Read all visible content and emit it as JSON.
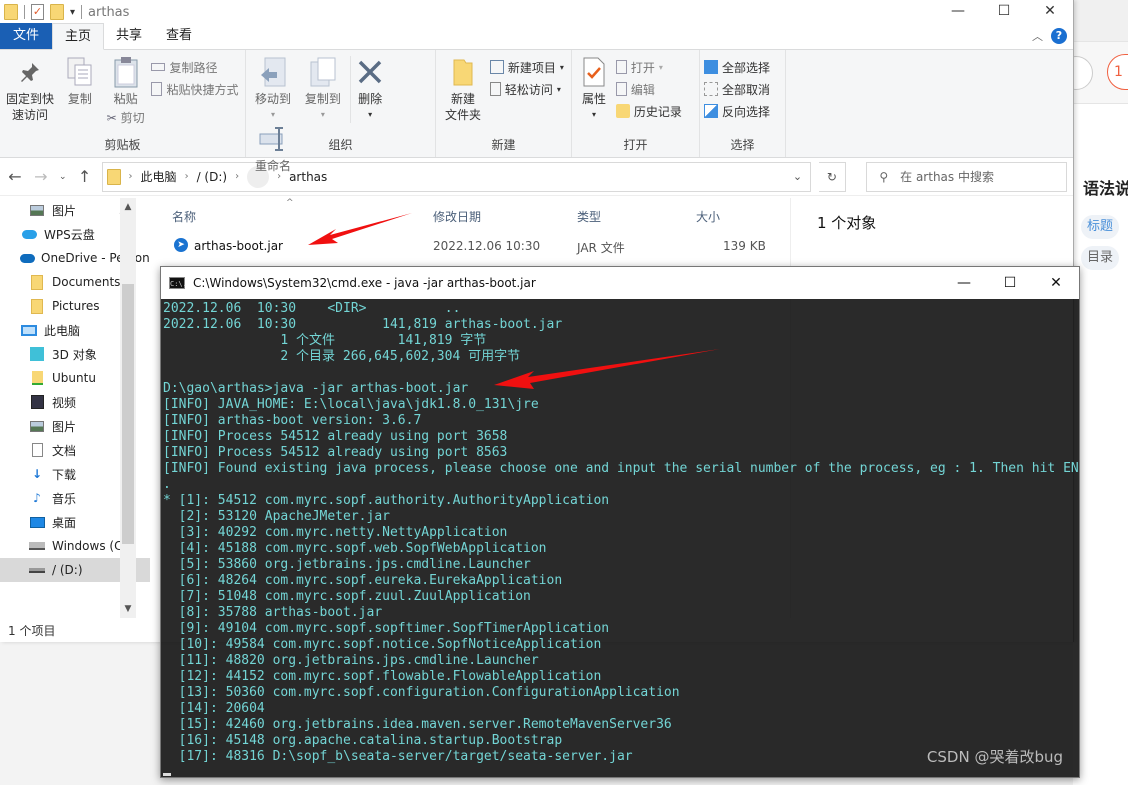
{
  "explorer": {
    "title": "arthas",
    "window_controls": [
      "—",
      "☐",
      "✕"
    ],
    "ribbon_tabs": [
      {
        "label": "文件",
        "kind": "file"
      },
      {
        "label": "主页",
        "kind": "active"
      },
      {
        "label": "共享",
        "kind": "normal"
      },
      {
        "label": "查看",
        "kind": "normal"
      }
    ],
    "ribbon": {
      "clipboard": {
        "label": "剪贴板",
        "pin_quick_access": "固定到快\n速访问",
        "copy": "复制",
        "paste": "粘贴",
        "copy_path": "复制路径",
        "paste_shortcut": "粘贴快捷方式",
        "cut": "剪切"
      },
      "organize": {
        "label": "组织",
        "move_to": "移动到",
        "copy_to": "复制到",
        "delete": "删除",
        "rename": "重命名"
      },
      "new": {
        "label": "新建",
        "new_folder": "新建\n文件夹",
        "new_item": "新建项目",
        "easy_access": "轻松访问"
      },
      "open": {
        "label": "打开",
        "properties": "属性",
        "open": "打开",
        "edit": "编辑",
        "history": "历史记录"
      },
      "select": {
        "label": "选择",
        "select_all": "全部选择",
        "select_none": "全部取消",
        "invert": "反向选择"
      }
    },
    "address": {
      "crumbs": [
        "此电脑",
        "/ (D:)",
        "arthas"
      ]
    },
    "search": {
      "placeholder": "在 arthas 中搜索"
    },
    "nav_pane": [
      {
        "label": "图片",
        "icon": "pictures-icon",
        "level": 2,
        "pinned": true
      },
      {
        "label": "WPS云盘",
        "icon": "cloud-icon",
        "level": 1
      },
      {
        "label": "OneDrive - Personal",
        "icon": "onedrive-icon",
        "level": 1
      },
      {
        "label": "Documents",
        "icon": "folder-icon",
        "level": 2
      },
      {
        "label": "Pictures",
        "icon": "folder-icon",
        "level": 2
      },
      {
        "label": "此电脑",
        "icon": "computer-icon",
        "level": 1
      },
      {
        "label": "3D 对象",
        "icon": "3d-objects-icon",
        "level": 2
      },
      {
        "label": "Ubuntu",
        "icon": "network-folder-icon",
        "level": 2
      },
      {
        "label": "视频",
        "icon": "videos-icon",
        "level": 2
      },
      {
        "label": "图片",
        "icon": "pictures-icon",
        "level": 2
      },
      {
        "label": "文档",
        "icon": "documents-icon",
        "level": 2
      },
      {
        "label": "下载",
        "icon": "downloads-icon",
        "level": 2
      },
      {
        "label": "音乐",
        "icon": "music-icon",
        "level": 2
      },
      {
        "label": "桌面",
        "icon": "desktop-icon",
        "level": 2
      },
      {
        "label": "Windows (C:)",
        "icon": "drive-c-icon",
        "level": 2
      },
      {
        "label": "/ (D:)",
        "icon": "drive-d-icon",
        "level": 2,
        "selected": true
      }
    ],
    "columns": [
      "名称",
      "修改日期",
      "类型",
      "大小"
    ],
    "files": [
      {
        "name": "arthas-boot.jar",
        "modified": "2022.12.06 10:30",
        "type": "JAR 文件",
        "size": "139 KB"
      }
    ],
    "details": "1 个对象",
    "status": "1 个项目"
  },
  "cmd": {
    "title": "C:\\Windows\\System32\\cmd.exe - java  -jar arthas-boot.jar",
    "icon_text": "C:\\.",
    "lines": [
      "2022.12.06  10:30    <DIR>          ..",
      "2022.12.06  10:30           141,819 arthas-boot.jar",
      "               1 个文件        141,819 字节",
      "               2 个目录 266,645,602,304 可用字节",
      "",
      "D:\\gao\\arthas>java -jar arthas-boot.jar",
      "[INFO] JAVA_HOME: E:\\local\\java\\jdk1.8.0_131\\jre",
      "[INFO] arthas-boot version: 3.6.7",
      "[INFO] Process 54512 already using port 3658",
      "[INFO] Process 54512 already using port 8563",
      "[INFO] Found existing java process, please choose one and input the serial number of the process, eg : 1. Then hit ENTER",
      ".",
      "* [1]: 54512 com.myrc.sopf.authority.AuthorityApplication",
      "  [2]: 53120 ApacheJMeter.jar",
      "  [3]: 40292 com.myrc.netty.NettyApplication",
      "  [4]: 45188 com.myrc.sopf.web.SopfWebApplication",
      "  [5]: 53860 org.jetbrains.jps.cmdline.Launcher",
      "  [6]: 48264 com.myrc.sopf.eureka.EurekaApplication",
      "  [7]: 51048 com.myrc.sopf.zuul.ZuulApplication",
      "  [8]: 35788 arthas-boot.jar",
      "  [9]: 49104 com.myrc.sopf.sopftimer.SopfTimerApplication",
      "  [10]: 49584 com.myrc.sopf.notice.SopfNoticeApplication",
      "  [11]: 48820 org.jetbrains.jps.cmdline.Launcher",
      "  [12]: 44152 com.myrc.sopf.flowable.FlowableApplication",
      "  [13]: 50360 com.myrc.sopf.configuration.ConfigurationApplication",
      "  [14]: 20604",
      "  [15]: 42460 org.jetbrains.idea.maven.server.RemoteMavenServer36",
      "  [16]: 45148 org.apache.catalina.startup.Bootstrap",
      "  [17]: 48316 D:\\sopf_b\\seata-server/target/seata-server.jar"
    ],
    "window_controls": [
      "—",
      "☐",
      "✕"
    ]
  },
  "background_editor": {
    "heading": "语法说",
    "chips": [
      "标题",
      "目录"
    ],
    "pill_text": "1"
  },
  "watermark": "CSDN @哭着改bug",
  "colors": {
    "accent": "#1a5fb4",
    "terminal_text": "#73d5d5",
    "arrow": "#f01010"
  }
}
